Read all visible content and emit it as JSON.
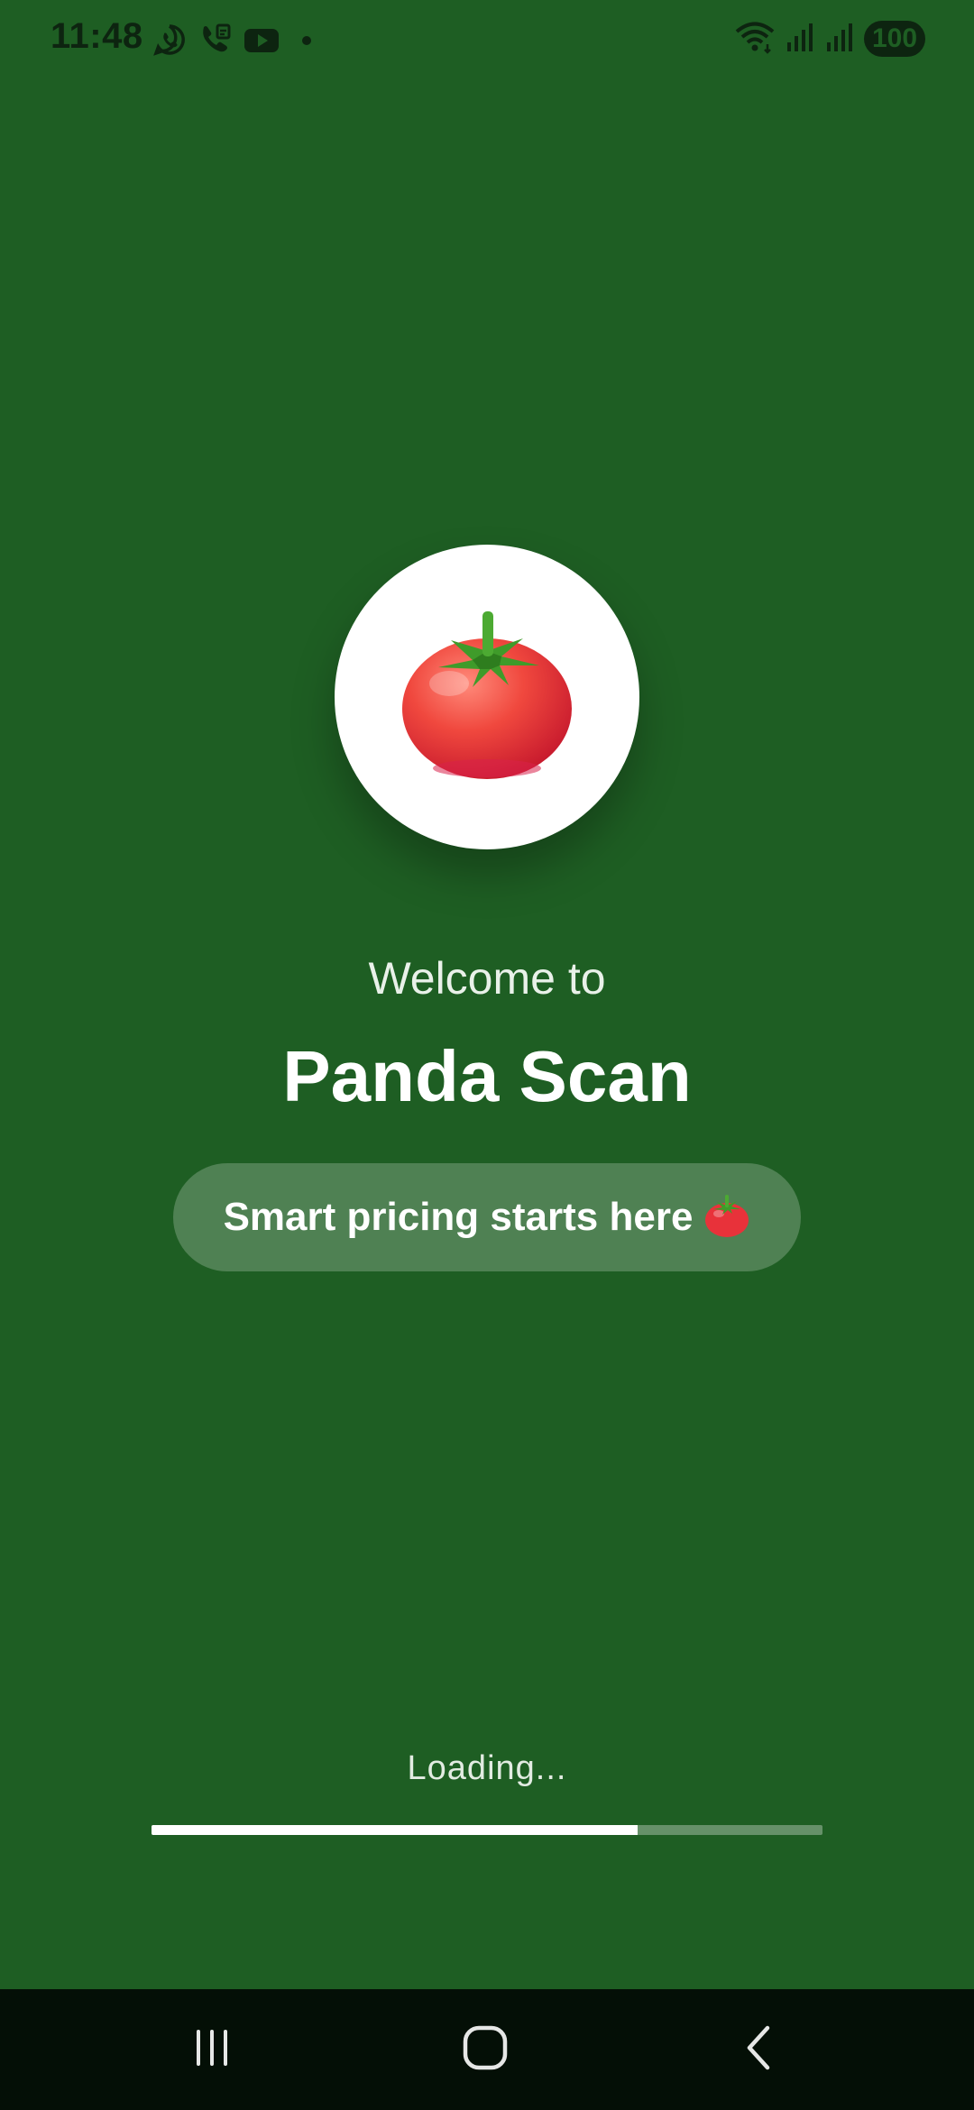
{
  "status_bar": {
    "time": "11:48",
    "battery": "100",
    "notification_icons": [
      "whatsapp-icon",
      "call-icon",
      "youtube-icon",
      "dot-icon"
    ],
    "system_icons": [
      "wifi-icon",
      "signal-icon",
      "signal-icon"
    ]
  },
  "splash": {
    "logo_icon": "tomato-icon",
    "welcome": "Welcome to",
    "title": "Panda Scan",
    "tagline": "Smart pricing starts here",
    "tagline_icon": "tomato-icon"
  },
  "loading": {
    "label": "Loading...",
    "progress": 0.725
  },
  "navigation": {
    "buttons": [
      "recent-apps",
      "home",
      "back"
    ]
  },
  "colors": {
    "background": "#1e5e23",
    "progress_fill": "#ffffff",
    "nav_bar": "#040f06"
  }
}
